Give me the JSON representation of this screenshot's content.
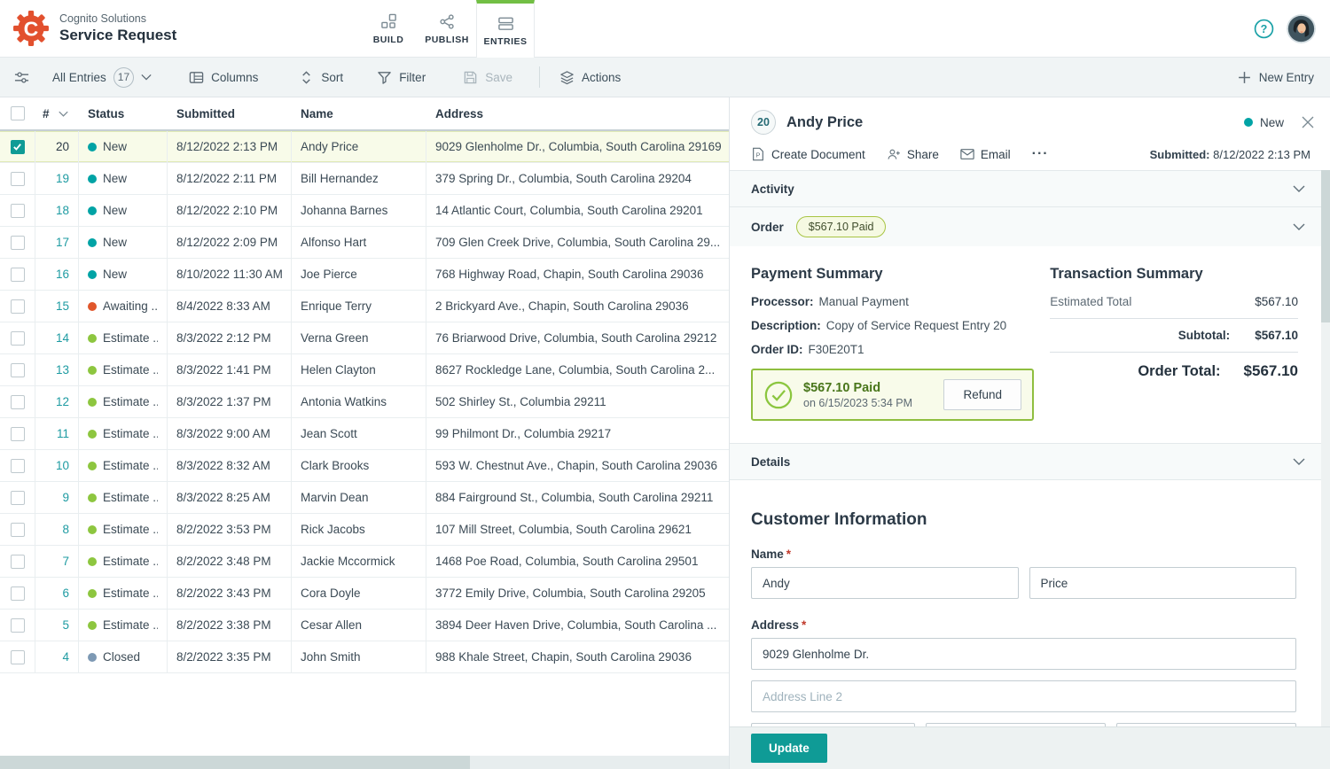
{
  "colors": {
    "accent_teal": "#0f9b96",
    "accent_green": "#72bf44",
    "logo_orange": "#e2502e",
    "status": {
      "new": "#00a3a5",
      "awaiting": "#e0562b",
      "estimate": "#8dc63f",
      "closed": "#7d99b4"
    },
    "selected_row_bg": "#f8fbe9",
    "paid_text_green": "#49761b"
  },
  "icons": {
    "logo": "gear-with-C",
    "build": "blocks-grid",
    "publish": "share-nodes",
    "entries": "stacked-rows",
    "help": "question-circle",
    "view_options": "sliders",
    "columns": "table",
    "sort": "chevrons-up-down",
    "filter": "funnel",
    "save": "floppy-disk",
    "actions": "layers",
    "new_entry": "plus",
    "create_document": "document-P",
    "share": "person-plus",
    "email": "envelope",
    "paid_check": "check-circle"
  },
  "header": {
    "brand_name": "Cognito Solutions",
    "form_title": "Service Request",
    "tabs": {
      "build": "BUILD",
      "publish": "PUBLISH",
      "entries": "ENTRIES"
    }
  },
  "toolbar": {
    "view_filter": "All Entries",
    "count": "17",
    "columns": "Columns",
    "sort": "Sort",
    "filter": "Filter",
    "save": "Save",
    "actions": "Actions",
    "new_entry": "New Entry"
  },
  "table": {
    "headers": {
      "number": "#",
      "status": "Status",
      "submitted": "Submitted",
      "name": "Name",
      "address": "Address"
    },
    "rows": [
      {
        "num": "20",
        "status": "New",
        "status_key": "new",
        "submitted": "8/12/2022 2:13 PM",
        "name": "Andy Price",
        "address": "9029 Glenholme Dr., Columbia, South Carolina 29169",
        "selected": true
      },
      {
        "num": "19",
        "status": "New",
        "status_key": "new",
        "submitted": "8/12/2022 2:11 PM",
        "name": "Bill Hernandez",
        "address": "379 Spring Dr., Columbia, South Carolina 29204"
      },
      {
        "num": "18",
        "status": "New",
        "status_key": "new",
        "submitted": "8/12/2022 2:10 PM",
        "name": "Johanna Barnes",
        "address": "14 Atlantic Court, Columbia, South Carolina 29201"
      },
      {
        "num": "17",
        "status": "New",
        "status_key": "new",
        "submitted": "8/12/2022 2:09 PM",
        "name": "Alfonso Hart",
        "address": "709 Glen Creek Drive, Columbia, South Carolina 29..."
      },
      {
        "num": "16",
        "status": "New",
        "status_key": "new",
        "submitted": "8/10/2022 11:30 AM",
        "name": "Joe Pierce",
        "address": "768 Highway Road, Chapin, South Carolina 29036"
      },
      {
        "num": "15",
        "status": "Awaiting ...",
        "status_key": "awaiting",
        "submitted": "8/4/2022 8:33 AM",
        "name": "Enrique Terry",
        "address": "2 Brickyard Ave., Chapin, South Carolina 29036"
      },
      {
        "num": "14",
        "status": "Estimate ...",
        "status_key": "estimate",
        "submitted": "8/3/2022 2:12 PM",
        "name": "Verna Green",
        "address": "76 Briarwood Drive, Columbia, South Carolina 29212"
      },
      {
        "num": "13",
        "status": "Estimate ...",
        "status_key": "estimate",
        "submitted": "8/3/2022 1:41 PM",
        "name": "Helen Clayton",
        "address": "8627 Rockledge Lane, Columbia, South Carolina 2..."
      },
      {
        "num": "12",
        "status": "Estimate ...",
        "status_key": "estimate",
        "submitted": "8/3/2022 1:37 PM",
        "name": "Antonia Watkins",
        "address": "502 Shirley St., Columbia 29211"
      },
      {
        "num": "11",
        "status": "Estimate ...",
        "status_key": "estimate",
        "submitted": "8/3/2022 9:00 AM",
        "name": "Jean Scott",
        "address": "99 Philmont Dr., Columbia 29217"
      },
      {
        "num": "10",
        "status": "Estimate ...",
        "status_key": "estimate",
        "submitted": "8/3/2022 8:32 AM",
        "name": "Clark Brooks",
        "address": "593 W. Chestnut Ave., Chapin, South Carolina 29036"
      },
      {
        "num": "9",
        "status": "Estimate ...",
        "status_key": "estimate",
        "submitted": "8/3/2022 8:25 AM",
        "name": "Marvin Dean",
        "address": "884 Fairground St., Columbia, South Carolina 29211"
      },
      {
        "num": "8",
        "status": "Estimate ...",
        "status_key": "estimate",
        "submitted": "8/2/2022 3:53 PM",
        "name": "Rick Jacobs",
        "address": "107 Mill Street, Columbia, South Carolina 29621"
      },
      {
        "num": "7",
        "status": "Estimate ...",
        "status_key": "estimate",
        "submitted": "8/2/2022 3:48 PM",
        "name": "Jackie Mccormick",
        "address": "1468 Poe Road, Columbia, South Carolina 29501"
      },
      {
        "num": "6",
        "status": "Estimate ...",
        "status_key": "estimate",
        "submitted": "8/2/2022 3:43 PM",
        "name": "Cora Doyle",
        "address": "3772 Emily Drive, Columbia, South Carolina 29205"
      },
      {
        "num": "5",
        "status": "Estimate ...",
        "status_key": "estimate",
        "submitted": "8/2/2022 3:38 PM",
        "name": "Cesar Allen",
        "address": "3894 Deer Haven Drive, Columbia, South Carolina ..."
      },
      {
        "num": "4",
        "status": "Closed",
        "status_key": "closed",
        "submitted": "8/2/2022 3:35 PM",
        "name": "John Smith",
        "address": "988 Khale Street, Chapin, South Carolina 29036"
      }
    ]
  },
  "panel": {
    "number": "20",
    "name": "Andy Price",
    "status": "New",
    "actions": {
      "create_document": "Create Document",
      "share": "Share",
      "email": "Email",
      "more": "···"
    },
    "submitted_label": "Submitted:",
    "submitted_value": "8/12/2022 2:13 PM",
    "sections": {
      "activity": "Activity",
      "order": "Order",
      "details": "Details"
    },
    "order": {
      "paid_badge": "$567.10 Paid",
      "payment": {
        "title": "Payment Summary",
        "processor_label": "Processor:",
        "processor": "Manual Payment",
        "description_label": "Description:",
        "description": "Copy of Service Request Entry 20",
        "order_id_label": "Order ID:",
        "order_id": "F30E20T1"
      },
      "paid": {
        "amount": "$567.10 Paid",
        "date": "on 6/15/2023 5:34 PM",
        "refund_label": "Refund"
      },
      "transaction": {
        "title": "Transaction Summary",
        "estimated_label": "Estimated Total",
        "estimated_value": "$567.10",
        "subtotal_label": "Subtotal:",
        "subtotal_value": "$567.10",
        "total_label": "Order Total:",
        "total_value": "$567.10"
      }
    },
    "form": {
      "heading": "Customer Information",
      "name_label": "Name",
      "required_mark": "*",
      "first_name": "Andy",
      "last_name": "Price",
      "address_label": "Address",
      "address_line1": "9029 Glenholme Dr.",
      "address_line2_placeholder": "Address Line 2",
      "update_label": "Update"
    }
  }
}
